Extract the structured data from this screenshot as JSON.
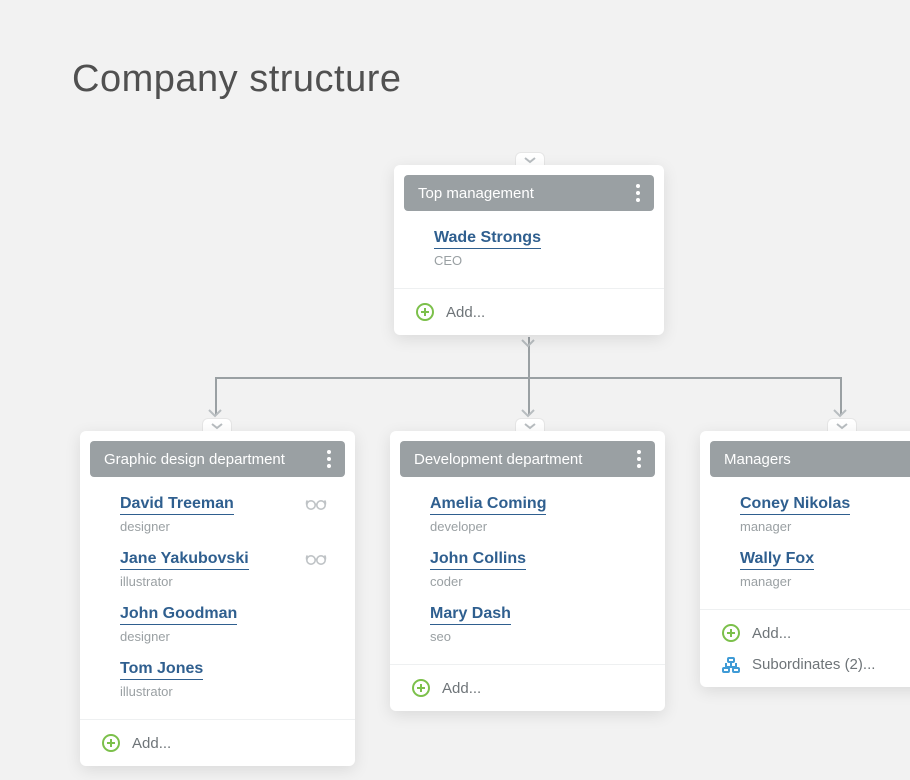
{
  "pageTitle": "Company structure",
  "addLabel": "Add...",
  "subordinatesLabel": "Subordinates (2)...",
  "nodes": {
    "top": {
      "title": "Top management",
      "members": [
        {
          "name": "Wade Strongs",
          "role": "CEO",
          "glasses": false
        }
      ],
      "showAdd": true,
      "showSubs": false
    },
    "design": {
      "title": "Graphic design department",
      "members": [
        {
          "name": "David Treeman",
          "role": "designer",
          "glasses": true
        },
        {
          "name": "Jane Yakubovski",
          "role": "illustrator",
          "glasses": true
        },
        {
          "name": "John Goodman",
          "role": "designer",
          "glasses": false
        },
        {
          "name": "Tom Jones",
          "role": "illustrator",
          "glasses": false
        }
      ],
      "showAdd": true,
      "showSubs": false
    },
    "dev": {
      "title": "Development department",
      "members": [
        {
          "name": "Amelia Coming",
          "role": "developer",
          "glasses": false
        },
        {
          "name": "John Collins",
          "role": "coder",
          "glasses": false
        },
        {
          "name": "Mary Dash",
          "role": "seo",
          "glasses": false
        }
      ],
      "showAdd": true,
      "showSubs": false
    },
    "managers": {
      "title": "Managers",
      "members": [
        {
          "name": "Coney Nikolas",
          "role": "manager",
          "glasses": false
        },
        {
          "name": "Wally Fox",
          "role": "manager",
          "glasses": false
        }
      ],
      "showAdd": true,
      "showSubs": true
    }
  }
}
